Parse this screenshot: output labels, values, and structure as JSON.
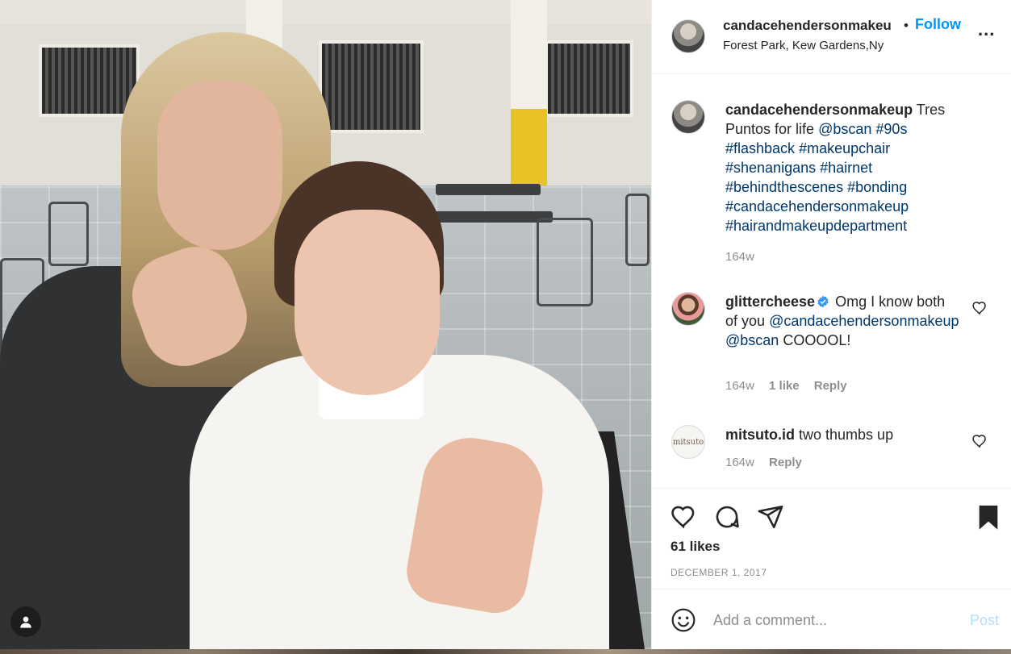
{
  "post": {
    "header": {
      "username": "candacehendersonmakeu",
      "dot": "•",
      "follow_label": "Follow",
      "location": "Forest Park, Kew Gardens,Ny",
      "more_label": "..."
    },
    "caption": {
      "username": "candacehendersonmakeup",
      "text": "Tres Puntos for life",
      "mention": "@bscan",
      "hashtags": [
        "#90s",
        "#flashback",
        "#makeupchair",
        "#shenanigans",
        "#hairnet",
        "#behindthescenes",
        "#bonding",
        "#candacehendersonmakeup",
        "#hairandmakeupdepartment"
      ],
      "time": "164w"
    },
    "comments": [
      {
        "username": "glittercheese",
        "verified": true,
        "text": "Omg I know both of you",
        "mentions": [
          "@candacehendersonmakeup",
          "@bscan"
        ],
        "suffix": "COOOOL!",
        "time": "164w",
        "likes": "1 like",
        "reply_label": "Reply"
      },
      {
        "username": "mitsuto.id",
        "verified": false,
        "text": "two thumbs up",
        "avatar_text": "mitsuto",
        "time": "164w",
        "reply_label": "Reply"
      }
    ],
    "likes": "61 likes",
    "date": "DECEMBER 1, 2017",
    "add_comment": {
      "placeholder": "Add a comment...",
      "post_label": "Post"
    }
  },
  "icons": {
    "more": "more-options-icon",
    "like": "heart-icon",
    "comment": "comment-icon",
    "share": "paper-plane-icon",
    "save": "bookmark-icon",
    "emoji": "emoji-icon",
    "user_tag": "user-tag-icon",
    "verified": "verified-badge-icon"
  },
  "colors": {
    "link": "#00376b",
    "follow": "#0095f6",
    "muted": "#8e8e8e",
    "post_disabled": "#b2dffc",
    "text": "#262626"
  }
}
